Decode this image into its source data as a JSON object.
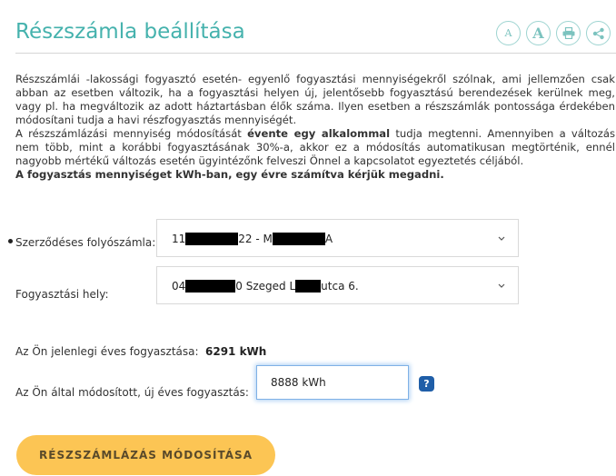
{
  "page": {
    "title": "Részszámla beállítása"
  },
  "toolbar": {
    "font_small_glyph": "A",
    "font_large_glyph": "A",
    "print_icon": "printer-icon",
    "share_icon": "share-icon"
  },
  "description": {
    "p1": "Részszámlái -lakossági fogyasztó esetén- egyenlő fogyasztási mennyiségekről szólnak, ami jellemzően csak abban az esetben változik, ha a fogyasztási helyen új, jelentősebb fogyasztású berendezések kerülnek meg, vagy pl. ha megváltozik az adott háztartásban élők száma. Ilyen esetben a részszámlák pontossága érdekében módosítani tudja a havi részfogyasztás mennyiségét.",
    "p2_before": "A részszámlázási mennyiség módosítását ",
    "p2_bold": "évente egy alkalommal",
    "p2_after": " tudja megtenni. Amennyiben a változás nem több, mint a korábbi fogyasztásának 30%-a, akkor ez a módosítás automatikusan megtörténik, ennél nagyobb mértékű változás esetén ügyintézőnk felveszi Önnel a kapcsolatot egyeztetés céljából.",
    "p3": "A fogyasztás mennyiséget kWh-ban, egy évre számítva kérjük megadni."
  },
  "contract": {
    "label": "Szerződéses folyószámla:",
    "value_part1": "11",
    "value_part2": "22 - M",
    "value_part3": "A"
  },
  "place": {
    "label": "Fogyasztási hely:",
    "value_part1": "04",
    "value_part2": "0 Szeged L",
    "value_part3": "utca 6."
  },
  "current": {
    "label": "Az Ön jelenlegi éves fogyasztása:",
    "value": "6291 kWh"
  },
  "new_consumption": {
    "label": "Az Ön által módosított, új éves fogyasztás:",
    "value": "8888 kWh",
    "help_glyph": "?"
  },
  "submit_label": "RÉSZSZÁMLÁZÁS MÓDOSÍTÁSA",
  "colors": {
    "accent": "#45b2ad",
    "button": "#fcc554",
    "help": "#1f5ea8"
  }
}
